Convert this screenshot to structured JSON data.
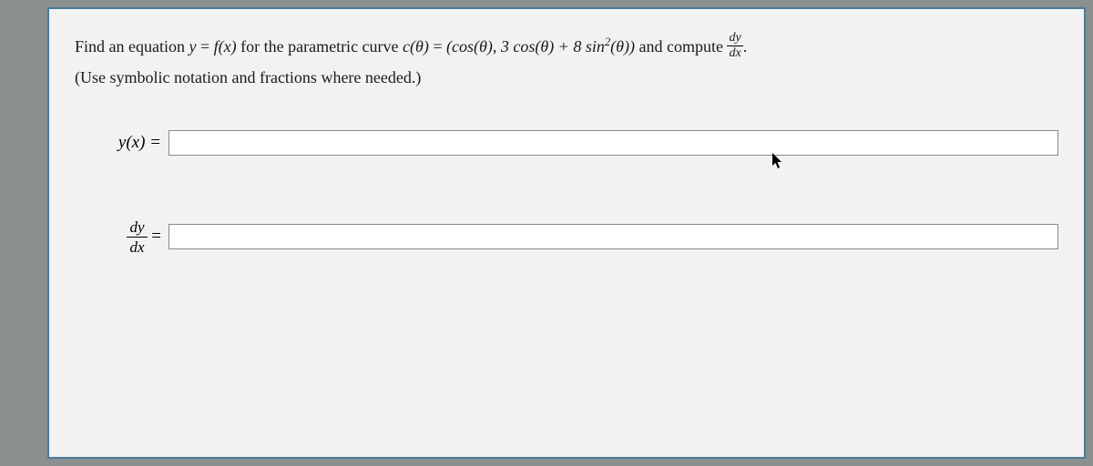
{
  "question": {
    "line1_prefix": "Find an equation ",
    "eq1_lhs": "y",
    "eq1_rhs": "f(x)",
    "mid1": " for the parametric curve ",
    "curve_lhs": "c(θ)",
    "curve_rhs_open": "(",
    "curve_x": "cos(θ)",
    "curve_sep": ", ",
    "curve_y": "3 cos(θ) + 8 sin²(θ)",
    "curve_rhs_close": ")",
    "mid2": " and compute ",
    "dydx_num": "dy",
    "dydx_den": "dx",
    "period": ".",
    "line2": "(Use symbolic notation and fractions where needed.)"
  },
  "answers": {
    "yx_label": "y(x) =",
    "yx_value": "",
    "dydx_num": "dy",
    "dydx_den": "dx",
    "dydx_eq": " =",
    "dydx_value": ""
  }
}
